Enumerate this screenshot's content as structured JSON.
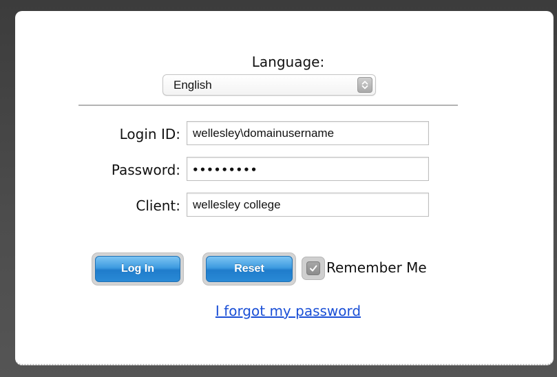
{
  "language": {
    "label": "Language:",
    "selected": "English"
  },
  "fields": {
    "login_id": {
      "label": "Login ID:",
      "value": "wellesley\\domainusername"
    },
    "password": {
      "label": "Password:",
      "masked": "•••••••••"
    },
    "client": {
      "label": "Client:",
      "value": "wellesley college"
    }
  },
  "buttons": {
    "login": "Log In",
    "reset": "Reset"
  },
  "remember_me": {
    "label": "Remember Me",
    "checked": true
  },
  "forgot_link": "I forgot my password",
  "colors": {
    "button_blue": "#2a8ad6",
    "link_blue": "#1a4fd6",
    "background": "#4a4a4a"
  }
}
